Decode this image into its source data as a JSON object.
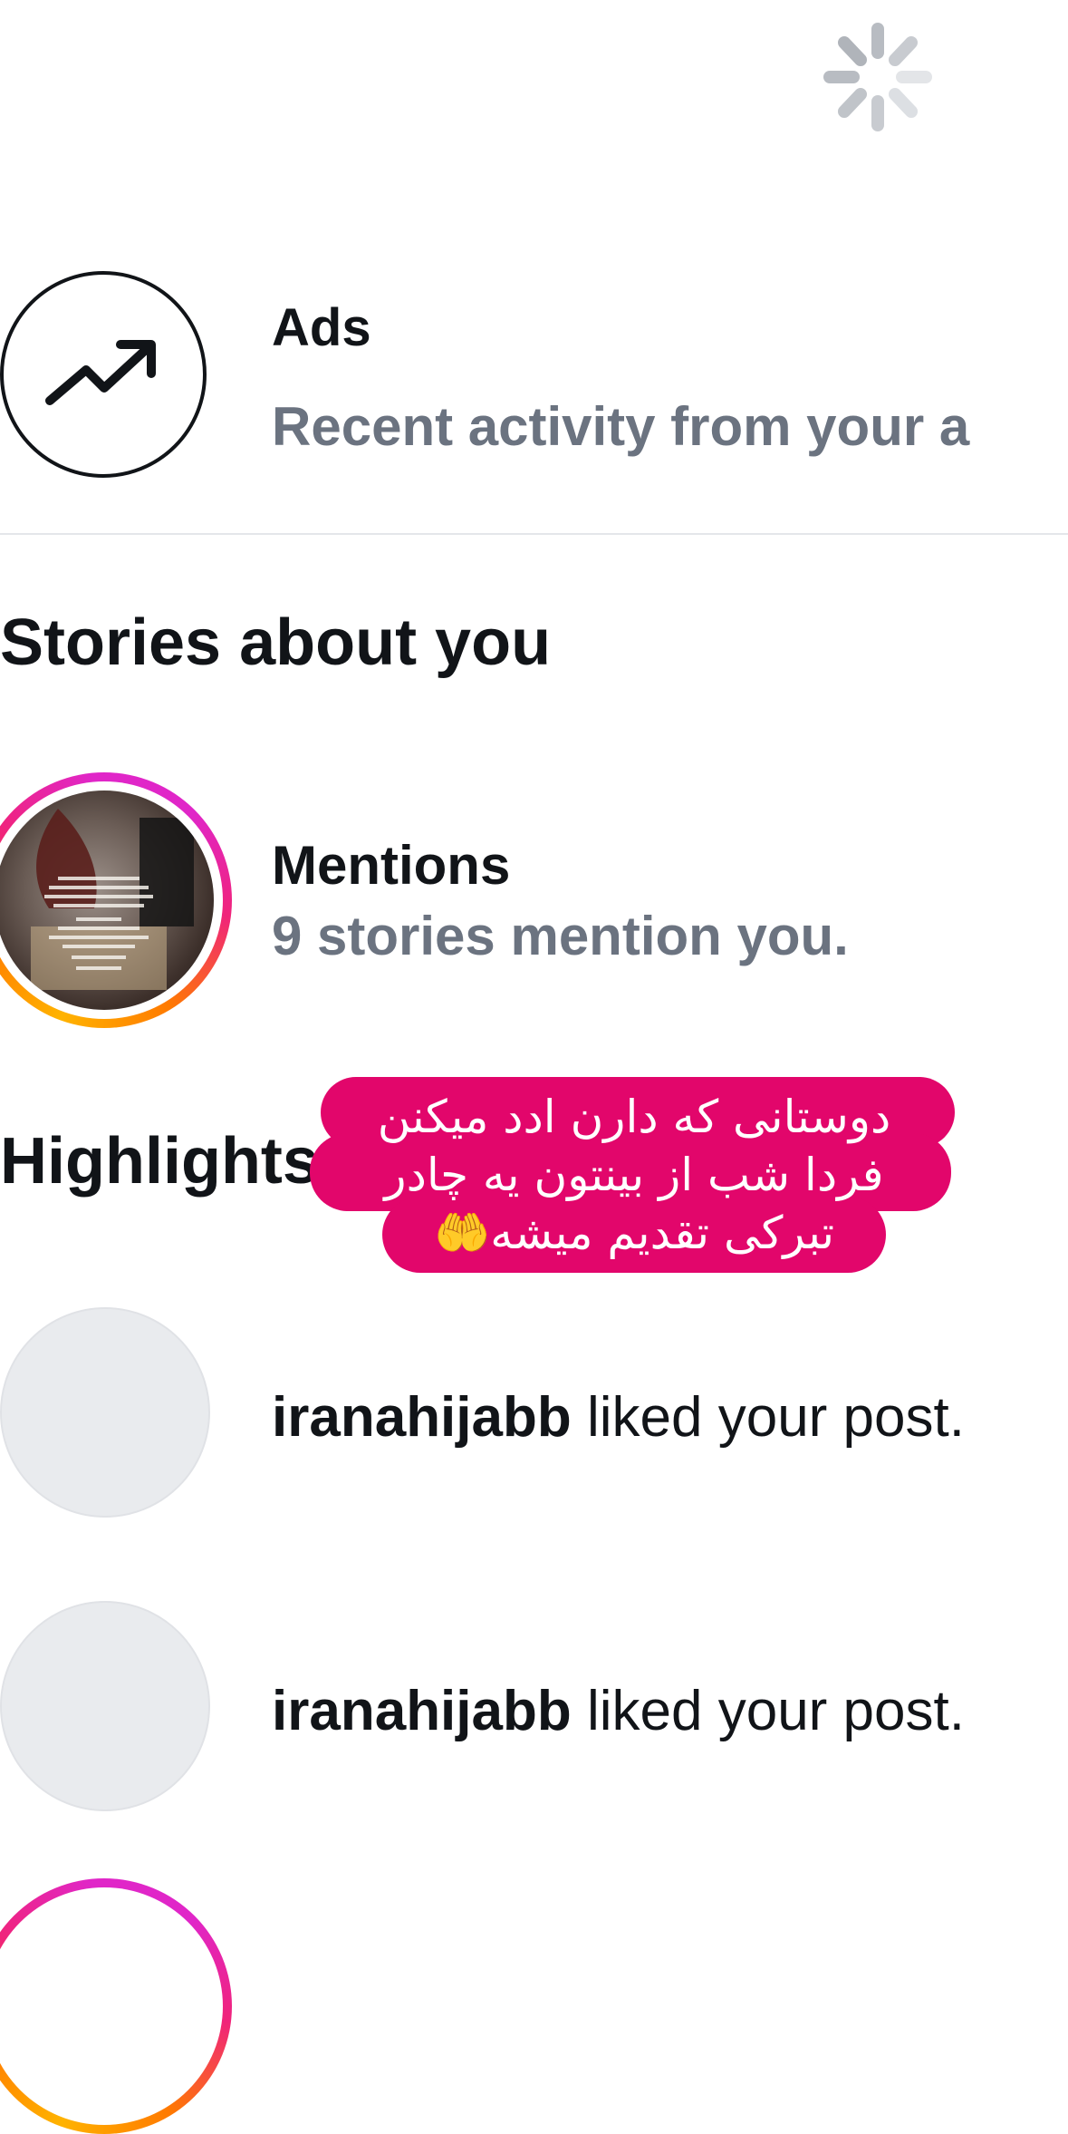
{
  "ads": {
    "title": "Ads",
    "subtitle": "Recent activity from your a"
  },
  "stories_section": {
    "title": "Stories about you",
    "mentions_title": "Mentions",
    "mentions_sub": "9 stories mention you."
  },
  "highlights": {
    "title": "Highlights"
  },
  "activity": [
    {
      "username": "iranahijabb",
      "action": " liked your post."
    },
    {
      "username": "iranahijabb",
      "action": " liked your post."
    }
  ],
  "sticker": {
    "line1": "دوستانی که دارن ادد میکنن",
    "line2": "فردا شب از بینتون یه چادر",
    "line3": "تبرکی تقدیم میشه🤲"
  },
  "icons": {
    "spinner": "loading-spinner-icon",
    "ads": "trending-up-icon"
  },
  "colors": {
    "sticker_bg": "#e2066b",
    "secondary_text": "#6b7380",
    "ring_pink": "#e026c8",
    "ring_orange": "#ffb300"
  }
}
